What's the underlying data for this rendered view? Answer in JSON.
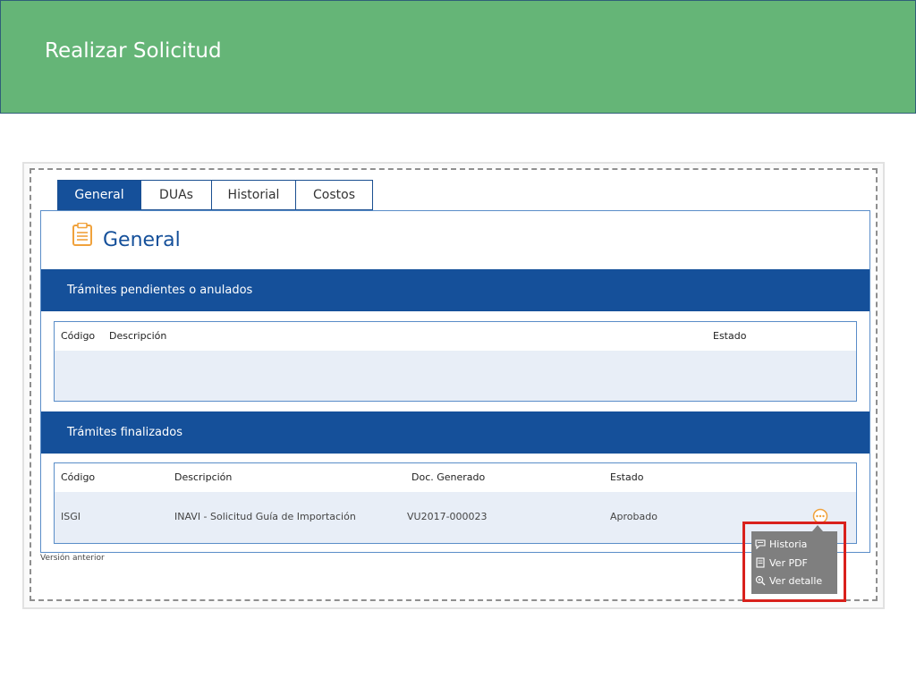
{
  "header": {
    "title": "Realizar Solicitud"
  },
  "tabs": [
    {
      "label": "General",
      "active": true
    },
    {
      "label": "DUAs",
      "active": false
    },
    {
      "label": "Historial",
      "active": false
    },
    {
      "label": "Costos",
      "active": false
    }
  ],
  "general": {
    "title": "General",
    "icon": "clipboard-icon"
  },
  "pending": {
    "title": "Trámites pendientes o anulados",
    "columns": [
      "Código",
      "Descripción",
      "Estado"
    ]
  },
  "finished": {
    "title": "Trámites finalizados",
    "columns": [
      "Código",
      "Descripción",
      "Doc. Generado",
      "Estado"
    ],
    "rows": [
      {
        "code": "ISGI",
        "description": "INAVI - Solicitud Guía de Importación",
        "doc": "VU2017-000023",
        "status": "Aprobado"
      }
    ]
  },
  "context_menu": {
    "items": [
      {
        "label": "Historia",
        "icon": "comment-icon"
      },
      {
        "label": "Ver PDF",
        "icon": "document-icon"
      },
      {
        "label": "Ver detalle",
        "icon": "zoom-icon"
      }
    ]
  },
  "footer": {
    "version_link": "Versión anterior"
  },
  "colors": {
    "banner": "#65b577",
    "primary": "#15509a",
    "highlight": "#d9211c",
    "menu": "#7f7f7f",
    "icon_orange": "#f0a23c"
  }
}
